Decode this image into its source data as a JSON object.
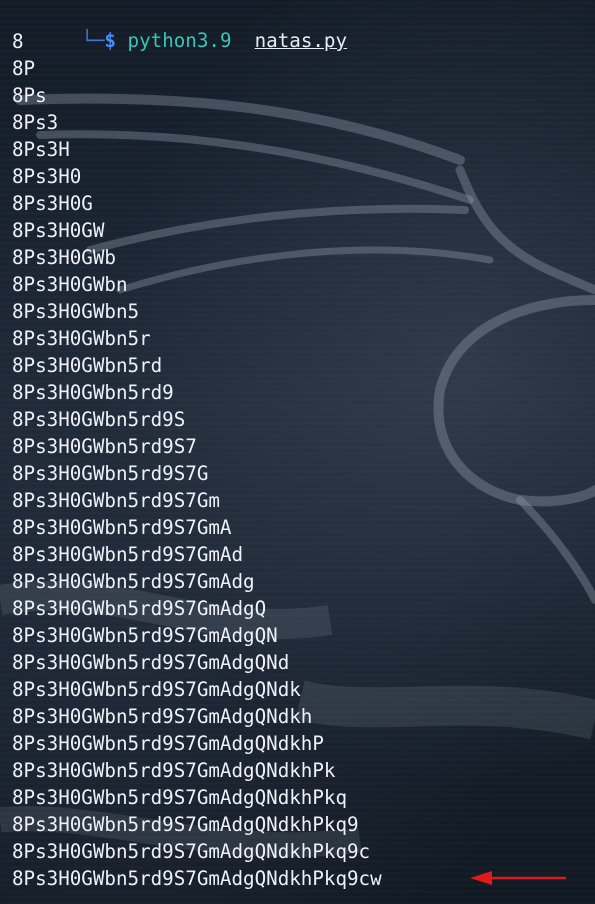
{
  "prompt": {
    "corner": "└─",
    "dollar": "$",
    "command": "python3.9",
    "argument": "natas.py"
  },
  "output": [
    "8",
    "8P",
    "8Ps",
    "8Ps3",
    "8Ps3H",
    "8Ps3H0",
    "8Ps3H0G",
    "8Ps3H0GW",
    "8Ps3H0GWb",
    "8Ps3H0GWbn",
    "8Ps3H0GWbn5",
    "8Ps3H0GWbn5r",
    "8Ps3H0GWbn5rd",
    "8Ps3H0GWbn5rd9",
    "8Ps3H0GWbn5rd9S",
    "8Ps3H0GWbn5rd9S7",
    "8Ps3H0GWbn5rd9S7G",
    "8Ps3H0GWbn5rd9S7Gm",
    "8Ps3H0GWbn5rd9S7GmA",
    "8Ps3H0GWbn5rd9S7GmAd",
    "8Ps3H0GWbn5rd9S7GmAdg",
    "8Ps3H0GWbn5rd9S7GmAdgQ",
    "8Ps3H0GWbn5rd9S7GmAdgQN",
    "8Ps3H0GWbn5rd9S7GmAdgQNd",
    "8Ps3H0GWbn5rd9S7GmAdgQNdk",
    "8Ps3H0GWbn5rd9S7GmAdgQNdkh",
    "8Ps3H0GWbn5rd9S7GmAdgQNdkhP",
    "8Ps3H0GWbn5rd9S7GmAdgQNdkhPk",
    "8Ps3H0GWbn5rd9S7GmAdgQNdkhPkq",
    "8Ps3H0GWbn5rd9S7GmAdgQNdkhPkq9",
    "8Ps3H0GWbn5rd9S7GmAdgQNdkhPkq9c",
    "8Ps3H0GWbn5rd9S7GmAdgQNdkhPkq9cw"
  ],
  "colors": {
    "prompt_dollar": "#4b8df8",
    "prompt_command": "#37c6b6",
    "output_text": "#eef2f8",
    "annotation_arrow": "#e01919",
    "background": "#131c27"
  },
  "icons": {
    "background": "kali-dragon-wallpaper",
    "annotation": "red-arrow-icon"
  }
}
